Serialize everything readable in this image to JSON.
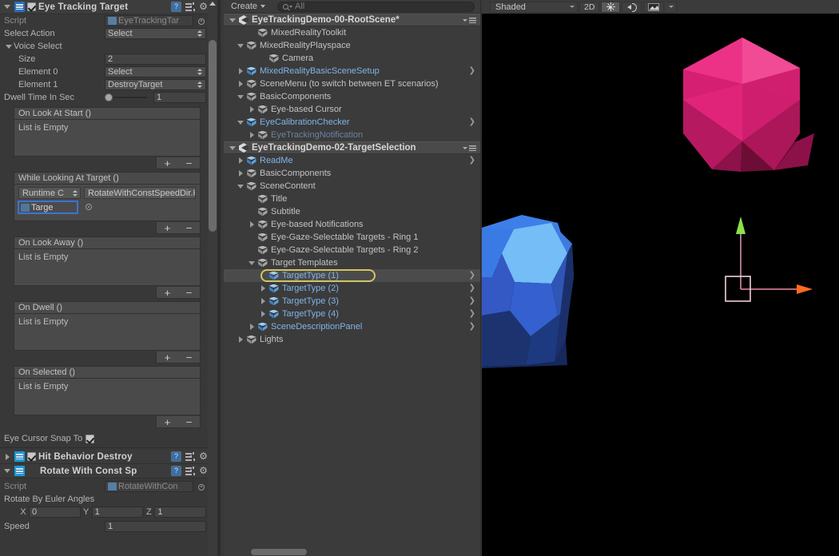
{
  "inspector": {
    "components": [
      {
        "name": "Eye Tracking Target",
        "enabled": true,
        "expanded": true,
        "icon": "script-icon",
        "header_icons": [
          "help-icon",
          "preset-icon",
          "gear-icon"
        ]
      }
    ],
    "script_label": "Script",
    "script_value": "EyeTrackingTar",
    "select_action_label": "Select Action",
    "select_action_value": "Select",
    "voice_select_label": "Voice Select",
    "size_label": "Size",
    "size_value": "2",
    "element0_label": "Element 0",
    "element0_value": "Select",
    "element1_label": "Element 1",
    "element1_value": "DestroyTarget",
    "dwell_label": "Dwell Time In Sec",
    "dwell_value": "1",
    "events": [
      {
        "title": "On Look At Start ()",
        "empty_text": "List is Empty",
        "add_label": "+",
        "remove_label": "−"
      },
      {
        "title": "On Look Away ()",
        "empty_text": "List is Empty",
        "add_label": "+",
        "remove_label": "−"
      },
      {
        "title": "On Dwell ()",
        "empty_text": "List is Empty",
        "add_label": "+",
        "remove_label": "−"
      },
      {
        "title": "On Selected ()",
        "empty_text": "List is Empty",
        "add_label": "+",
        "remove_label": "−"
      }
    ],
    "while_looking": {
      "title": "While Looking At Target ()",
      "runtime_value": "Runtime C",
      "function_value": "RotateWithConstSpeedDir.R",
      "object_value": "Targe",
      "add_label": "+",
      "remove_label": "−"
    },
    "eye_cursor_snap_label": "Eye Cursor Snap To",
    "eye_cursor_snap_checked": true,
    "hit_behavior": {
      "name": "Hit Behavior Destroy",
      "enabled": true,
      "expanded": false
    },
    "rotate_component": {
      "name": "Rotate With Const Sp",
      "expanded": true,
      "script_label": "Script",
      "script_value": "RotateWithCon",
      "euler_label": "Rotate By Euler Angles",
      "x_label": "X",
      "x_value": "0",
      "y_label": "Y",
      "y_value": "1",
      "z_label": "Z",
      "z_value": "1",
      "speed_label": "Speed",
      "speed_value": "1"
    }
  },
  "hierarchy": {
    "create_label": "Create",
    "search_placeholder": "All",
    "scenes": [
      {
        "name": "EyeTrackingDemo-00-RootScene*",
        "expanded": true,
        "rows": [
          {
            "label": "MixedRealityToolkit",
            "indent": 2,
            "arrow": "none",
            "icon": "gameobject-icon",
            "style": "normal",
            "chevron": false
          },
          {
            "label": "MixedRealityPlayspace",
            "indent": 1,
            "arrow": "down",
            "icon": "gameobject-icon",
            "style": "normal",
            "chevron": false
          },
          {
            "label": "Camera",
            "indent": 3,
            "arrow": "none",
            "icon": "gameobject-icon",
            "style": "normal",
            "chevron": false
          },
          {
            "label": "MixedRealityBasicSceneSetup",
            "indent": 1,
            "arrow": "right",
            "icon": "prefab-icon",
            "style": "prefab",
            "chevron": true
          },
          {
            "label": "SceneMenu (to switch between ET scenarios)",
            "indent": 1,
            "arrow": "right",
            "icon": "gameobject-icon",
            "style": "normal",
            "chevron": false
          },
          {
            "label": "BasicComponents",
            "indent": 1,
            "arrow": "down",
            "icon": "gameobject-icon",
            "style": "normal",
            "chevron": false
          },
          {
            "label": "Eye-based Cursor",
            "indent": 2,
            "arrow": "right",
            "icon": "gameobject-icon",
            "style": "normal",
            "chevron": false
          },
          {
            "label": "EyeCalibrationChecker",
            "indent": 1,
            "arrow": "down",
            "icon": "prefab-icon",
            "style": "prefab",
            "chevron": true
          },
          {
            "label": "EyeTrackingNotification",
            "indent": 2,
            "arrow": "right",
            "icon": "gameobject-icon",
            "style": "dim",
            "chevron": false
          }
        ]
      },
      {
        "name": "EyeTrackingDemo-02-TargetSelection",
        "expanded": true,
        "rows": [
          {
            "label": "ReadMe",
            "indent": 1,
            "arrow": "right",
            "icon": "prefab-icon",
            "style": "prefab",
            "chevron": true
          },
          {
            "label": "BasicComponents",
            "indent": 1,
            "arrow": "right",
            "icon": "gameobject-icon",
            "style": "normal",
            "chevron": false
          },
          {
            "label": "SceneContent",
            "indent": 1,
            "arrow": "down",
            "icon": "gameobject-icon",
            "style": "normal",
            "chevron": false
          },
          {
            "label": "Title",
            "indent": 2,
            "arrow": "none",
            "icon": "gameobject-icon",
            "style": "normal",
            "chevron": false
          },
          {
            "label": "Subtitle",
            "indent": 2,
            "arrow": "none",
            "icon": "gameobject-icon",
            "style": "normal",
            "chevron": false
          },
          {
            "label": "Eye-based Notifications",
            "indent": 2,
            "arrow": "right",
            "icon": "gameobject-icon",
            "style": "normal",
            "chevron": false
          },
          {
            "label": "Eye-Gaze-Selectable Targets - Ring 1",
            "indent": 2,
            "arrow": "none",
            "icon": "gameobject-icon",
            "style": "normal",
            "chevron": false
          },
          {
            "label": "Eye-Gaze-Selectable Targets - Ring 2",
            "indent": 2,
            "arrow": "none",
            "icon": "gameobject-icon",
            "style": "normal",
            "chevron": false
          },
          {
            "label": "Target Templates",
            "indent": 2,
            "arrow": "down",
            "icon": "gameobject-icon",
            "style": "normal",
            "chevron": false
          },
          {
            "label": "TargetType (1)",
            "indent": 3,
            "arrow": "none",
            "icon": "prefab-icon",
            "style": "prefab",
            "chevron": true,
            "selected": true,
            "highlight_ring": true
          },
          {
            "label": "TargetType (2)",
            "indent": 3,
            "arrow": "right",
            "icon": "prefab-icon",
            "style": "prefab",
            "chevron": true
          },
          {
            "label": "TargetType (3)",
            "indent": 3,
            "arrow": "right",
            "icon": "prefab-icon",
            "style": "prefab",
            "chevron": true
          },
          {
            "label": "TargetType (4)",
            "indent": 3,
            "arrow": "right",
            "icon": "prefab-icon",
            "style": "prefab",
            "chevron": true
          },
          {
            "label": "SceneDescriptionPanel",
            "indent": 2,
            "arrow": "right",
            "icon": "prefab-icon",
            "style": "prefab",
            "chevron": true
          },
          {
            "label": "Lights",
            "indent": 1,
            "arrow": "right",
            "icon": "gameobject-icon",
            "style": "normal",
            "chevron": false
          }
        ]
      }
    ]
  },
  "scene_view": {
    "shading_mode": "Shaded",
    "mode_2d_label": "2D",
    "lighting_icon": "sun-icon",
    "audio_icon": "audio-icon",
    "effects_icon": "image-effects-icon",
    "background_color": "#000000",
    "objects": [
      {
        "name": "blue-polyhedron",
        "color": "#2f6bdd"
      },
      {
        "name": "pink-icosahedron",
        "color": "#e0237f"
      }
    ],
    "gizmo": {
      "type": "move-gizmo",
      "y_axis_color": "#8fe04a",
      "x_axis_color": "#ff6a1e",
      "plane_handle_color": "#e8c8d8"
    }
  }
}
